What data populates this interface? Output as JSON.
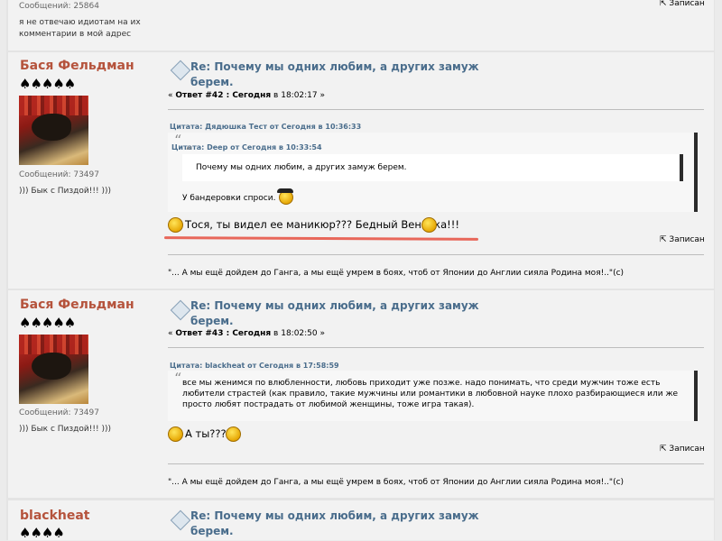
{
  "top_post": {
    "messages": "Сообщений: 25864",
    "signature_line1": "я не отвечаю идиотам на их",
    "signature_line2": "комментарии в мой адрес",
    "saved_label": "Записан"
  },
  "posts": [
    {
      "author": "Бася Фельдман",
      "stars": "♠♠♠♠♠",
      "messages": "Сообщений: 73497",
      "user_text": "))) Бык с Пиздой!!! )))",
      "title_line1": "Re: Почему мы одних любим, а других замуж",
      "title_line2": "берем.",
      "meta_prefix": "« ",
      "meta_bold": "Ответ #42 : Сегодня",
      "meta_time": " в 18:02:17 »",
      "quote_outer_head": "Цитата: Дядюшка Тест от Сегодня в 10:36:33",
      "quote_inner_head": "Цитата: Deep от Сегодня в 10:33:54",
      "quote_inner_text": "Почему мы одних любим, а других замуж берем.",
      "quote_outer_text": "У бандеровки спроси.",
      "body": "Тося, ты видел ее маникюр??? Бедный Веничка!!!",
      "saved_label": "Записан",
      "signature": "\"... А мы ещё дойдем до Ганга, а мы ещё умрем в боях, чтоб от Японии до Англии сияла Родина моя!..\"(c)"
    },
    {
      "author": "Бася Фельдман",
      "stars": "♠♠♠♠♠",
      "messages": "Сообщений: 73497",
      "user_text": "))) Бык с Пиздой!!! )))",
      "title_line1": "Re: Почему мы одних любим, а других замуж",
      "title_line2": "берем.",
      "meta_prefix": "« ",
      "meta_bold": "Ответ #43 : Сегодня",
      "meta_time": " в 18:02:50 »",
      "quote_head": "Цитата: blackheat от Сегодня в 17:58:59",
      "quote_text": "все мы женимся по влюбленности, любовь приходит уже позже. надо понимать, что среди мужчин тоже есть любители страстей (как правило, такие мужчины или романтики в любовной науке плохо разбирающиеся или же просто любят пострадать от любимой женщины, тоже игра такая).",
      "body": "А ты???",
      "saved_label": "Записан",
      "signature": "\"... А мы ещё дойдем до Ганга, а мы ещё умрем в боях, чтоб от Японии до Англии сияла Родина моя!..\"(c)"
    },
    {
      "author": "blackheat",
      "stars": "♠♠♠♠",
      "title_line1": "Re: Почему мы одних любим, а других замуж",
      "title_line2": "берем."
    }
  ]
}
